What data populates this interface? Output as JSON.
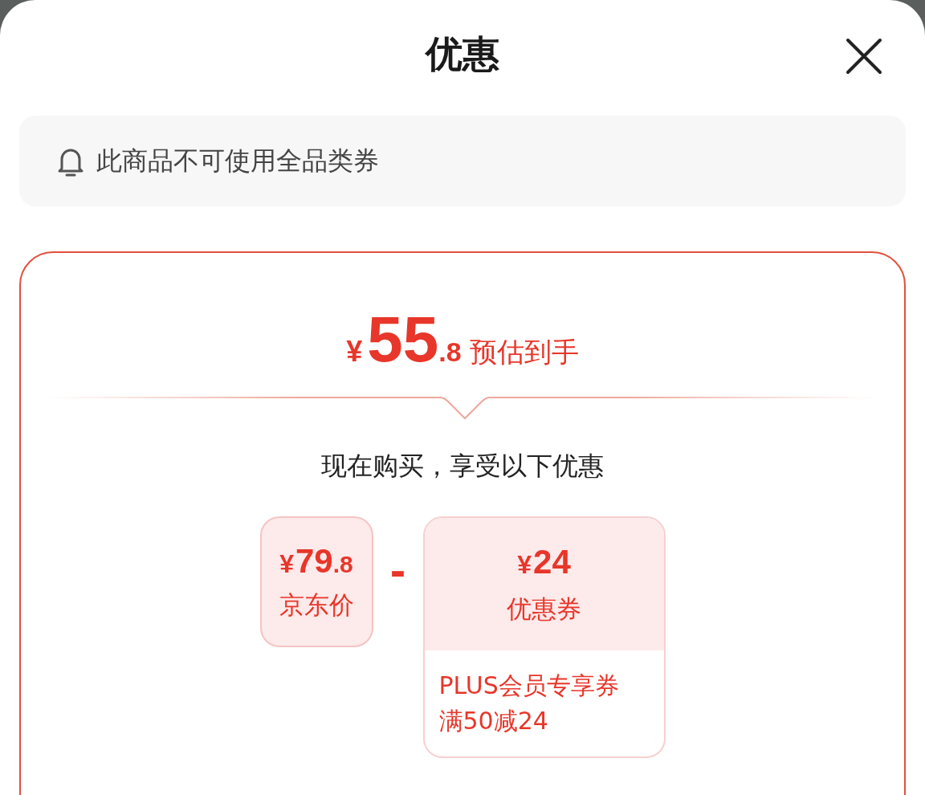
{
  "sheet": {
    "title": "优惠"
  },
  "notice": {
    "text": "此商品不可使用全品类券"
  },
  "estimate": {
    "currency": "¥",
    "integer": "55",
    "decimal": ".8",
    "label": "预估到手"
  },
  "subtitle": "现在购买，享受以下优惠",
  "breakdown": [
    {
      "kind": "price",
      "currency": "¥",
      "integer": "79",
      "decimal": ".8",
      "label": "京东价"
    },
    {
      "kind": "operator",
      "symbol": "-"
    },
    {
      "kind": "coupon",
      "currency": "¥",
      "integer": "24",
      "label": "优惠券",
      "details": [
        "PLUS会员专享券",
        "满50减24"
      ]
    }
  ]
}
